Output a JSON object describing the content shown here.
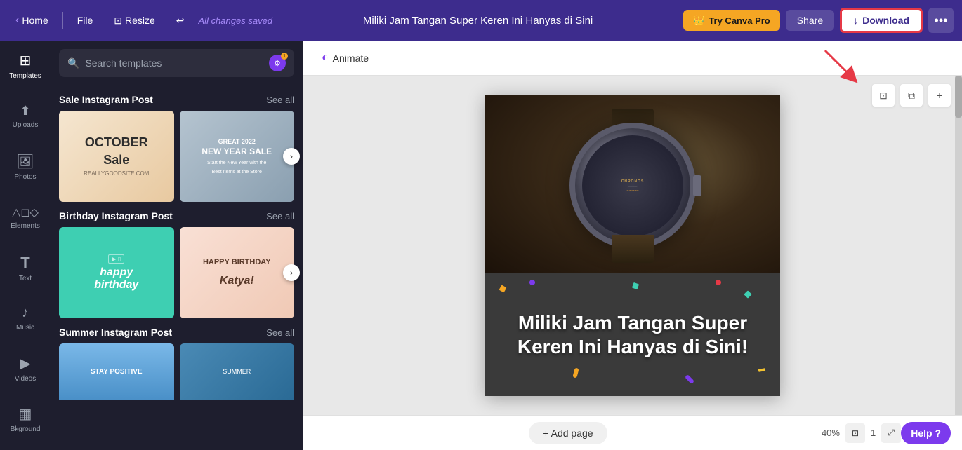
{
  "topbar": {
    "home_label": "Home",
    "file_label": "File",
    "resize_label": "Resize",
    "saved_text": "All changes saved",
    "title": "Miliki Jam Tangan Super Keren Ini Hanyas di Sini",
    "try_pro_label": "Try Canva Pro",
    "share_label": "Share",
    "download_label": "Download",
    "more_icon": "•••"
  },
  "sidebar": {
    "items": [
      {
        "id": "templates",
        "label": "Templates",
        "icon": "⊞"
      },
      {
        "id": "uploads",
        "label": "Uploads",
        "icon": "↑"
      },
      {
        "id": "photos",
        "label": "Photos",
        "icon": "🖼"
      },
      {
        "id": "elements",
        "label": "Elements",
        "icon": "△"
      },
      {
        "id": "text",
        "label": "Text",
        "icon": "T"
      },
      {
        "id": "music",
        "label": "Music",
        "icon": "♪"
      },
      {
        "id": "videos",
        "label": "Videos",
        "icon": "▶"
      },
      {
        "id": "background",
        "label": "Bkground",
        "icon": "▦"
      }
    ]
  },
  "templates_panel": {
    "search_placeholder": "Search templates",
    "sections": [
      {
        "id": "sale",
        "title": "Sale Instagram Post",
        "see_all_label": "See all",
        "cards": [
          {
            "id": "october",
            "type": "october",
            "text1": "OCTOBER",
            "text2": "Sale"
          },
          {
            "id": "newyear",
            "type": "newyear",
            "text1": "GREAT 2022",
            "text2": "NEW YEAR SALE",
            "text3": "Start the New Year with the Best Items at the Store"
          }
        ]
      },
      {
        "id": "birthday",
        "title": "Birthday Instagram Post",
        "see_all_label": "See all",
        "cards": [
          {
            "id": "happybday",
            "type": "birthday-green",
            "text1": "happy",
            "text2": "birthday"
          },
          {
            "id": "katya",
            "type": "birthday-pink",
            "text1": "HAPPY BIRTHDAY",
            "text2": "Katya!"
          }
        ]
      },
      {
        "id": "summer",
        "title": "Summer Instagram Post",
        "see_all_label": "See all",
        "cards": [
          {
            "id": "staypositive",
            "type": "stay",
            "text1": "STAY POSITIVE"
          }
        ]
      }
    ]
  },
  "canvas": {
    "animate_label": "Animate",
    "design_headline": "Miliki Jam Tangan Super Keren Ini Hanyas di Sini!",
    "add_page_label": "+ Add page",
    "zoom_level": "40%",
    "page_number": "1",
    "help_label": "Help ?",
    "watch_brand": "CHRONOS\nPRO"
  },
  "icons": {
    "search": "🔍",
    "filter": "⚙",
    "animate_circle": "◐",
    "back": "‹",
    "forward": "›",
    "home_arrow": "‹",
    "undo": "↩",
    "resize": "⊡",
    "copy_frame": "⧉",
    "add_section": "+",
    "download_arrow": "↓"
  }
}
